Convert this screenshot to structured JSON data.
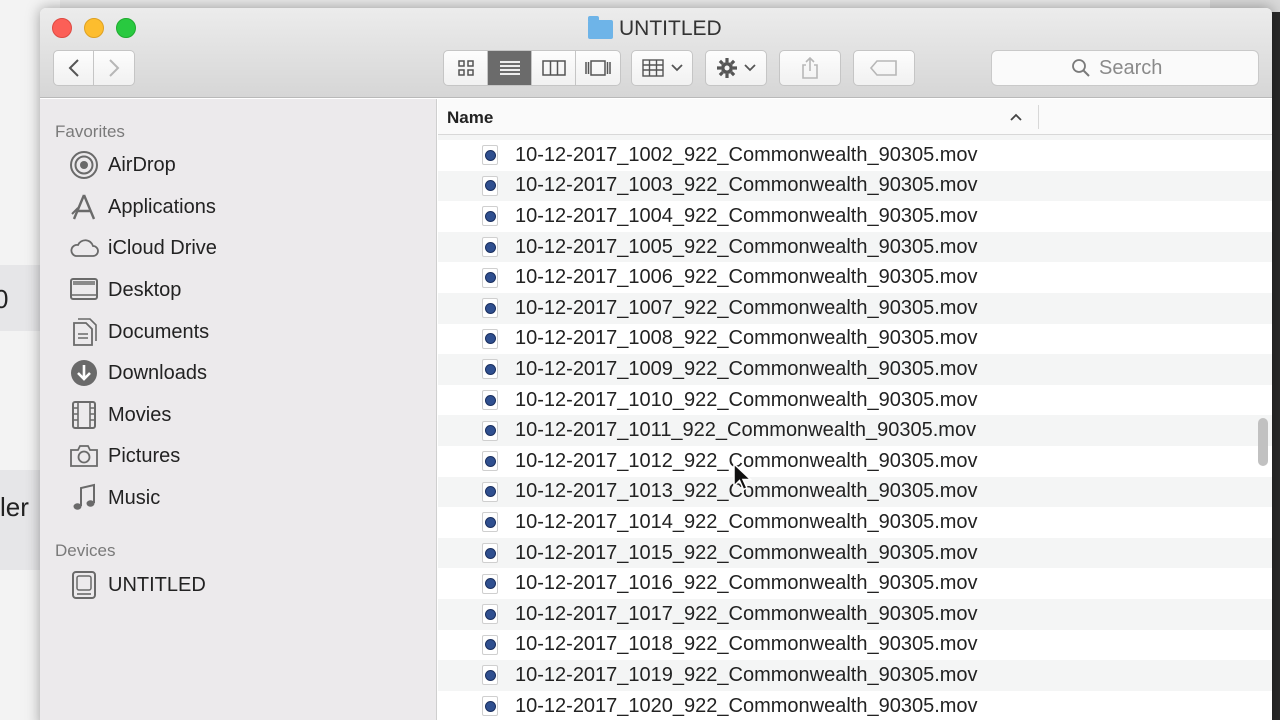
{
  "background": {
    "fragment_top": "0",
    "fragment_bottom": "ler"
  },
  "window": {
    "title": "UNTITLED"
  },
  "toolbar": {
    "back_glyph": "‹",
    "forward_glyph": "›",
    "search_placeholder": "Search"
  },
  "sidebar": {
    "favorites_heading": "Favorites",
    "favorites": [
      {
        "label": "AirDrop",
        "icon": "airdrop-icon"
      },
      {
        "label": "Applications",
        "icon": "applications-icon"
      },
      {
        "label": "iCloud Drive",
        "icon": "cloud-icon"
      },
      {
        "label": "Desktop",
        "icon": "desktop-icon"
      },
      {
        "label": "Documents",
        "icon": "documents-icon"
      },
      {
        "label": "Downloads",
        "icon": "downloads-icon"
      },
      {
        "label": "Movies",
        "icon": "movies-icon"
      },
      {
        "label": "Pictures",
        "icon": "camera-icon"
      },
      {
        "label": "Music",
        "icon": "music-icon"
      }
    ],
    "devices_heading": "Devices",
    "devices": [
      {
        "label": "UNTITLED",
        "icon": "disk-icon"
      }
    ]
  },
  "list": {
    "column_name": "Name",
    "files": [
      "10-12-2017_1002_922_Commonwealth_90305.mov",
      "10-12-2017_1003_922_Commonwealth_90305.mov",
      "10-12-2017_1004_922_Commonwealth_90305.mov",
      "10-12-2017_1005_922_Commonwealth_90305.mov",
      "10-12-2017_1006_922_Commonwealth_90305.mov",
      "10-12-2017_1007_922_Commonwealth_90305.mov",
      "10-12-2017_1008_922_Commonwealth_90305.mov",
      "10-12-2017_1009_922_Commonwealth_90305.mov",
      "10-12-2017_1010_922_Commonwealth_90305.mov",
      "10-12-2017_1011_922_Commonwealth_90305.mov",
      "10-12-2017_1012_922_Commonwealth_90305.mov",
      "10-12-2017_1013_922_Commonwealth_90305.mov",
      "10-12-2017_1014_922_Commonwealth_90305.mov",
      "10-12-2017_1015_922_Commonwealth_90305.mov",
      "10-12-2017_1016_922_Commonwealth_90305.mov",
      "10-12-2017_1017_922_Commonwealth_90305.mov",
      "10-12-2017_1018_922_Commonwealth_90305.mov",
      "10-12-2017_1019_922_Commonwealth_90305.mov",
      "10-12-2017_1020_922_Commonwealth_90305.mov"
    ]
  }
}
